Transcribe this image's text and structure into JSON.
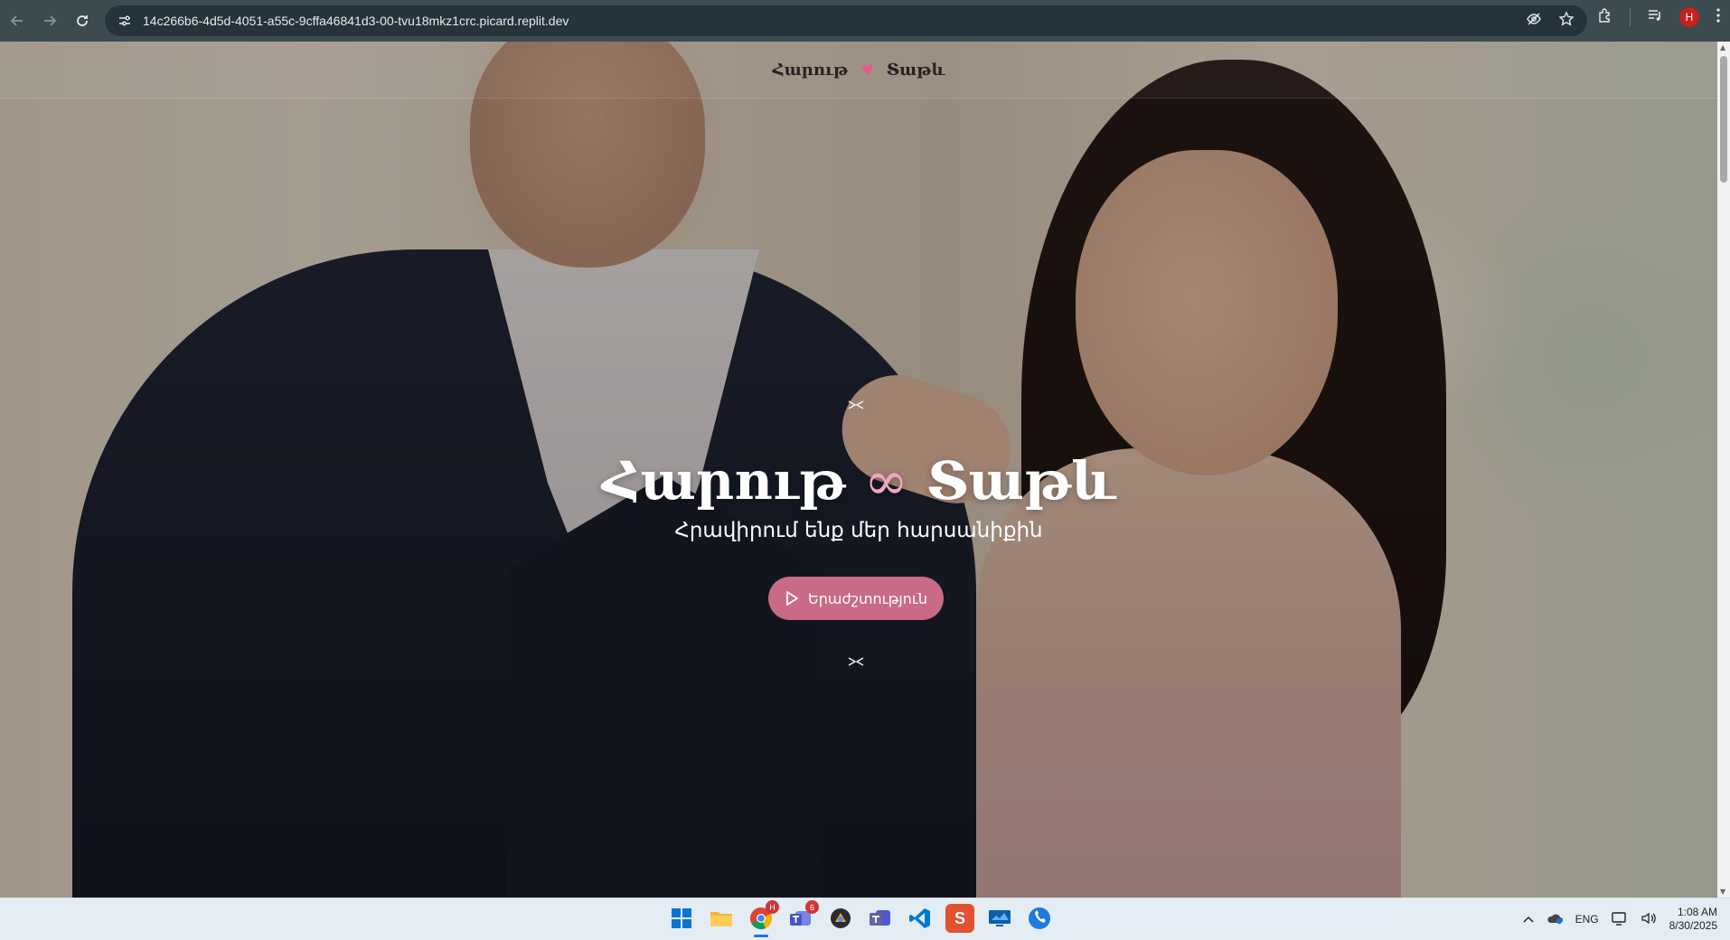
{
  "browser": {
    "url": "14c266b6-4d5d-4051-a55c-9cffa46841d3-00-tvu18mkz1crc.picard.replit.dev",
    "profile_initial": "H",
    "icons": [
      "back-icon",
      "forward-icon",
      "reload-icon",
      "site-info-icon",
      "eye-off-icon",
      "star-icon",
      "extensions-icon",
      "media-icon",
      "menu-icon"
    ]
  },
  "nav": {
    "groom": "Հարութ",
    "bride": "Տաթև",
    "heart": "♥"
  },
  "hero": {
    "ornament": "✂",
    "title_groom": "Հարութ",
    "title_symbol": "∞",
    "title_bride": "Տաթև",
    "subtitle": "Հրավիրում ենք մեր հարսանիքին",
    "music_button": "Երաժշտություն",
    "accent_color": "#c96a87"
  },
  "taskbar": {
    "apps": [
      {
        "name": "start",
        "label": ""
      },
      {
        "name": "file-explorer",
        "label": ""
      },
      {
        "name": "chrome",
        "label": "",
        "badge": "H"
      },
      {
        "name": "teams",
        "label": "",
        "badge": "6"
      },
      {
        "name": "app-circle",
        "label": ""
      },
      {
        "name": "teams-2",
        "label": ""
      },
      {
        "name": "vscode",
        "label": ""
      },
      {
        "name": "sublime",
        "label": "S"
      },
      {
        "name": "remote-desktop",
        "label": ""
      },
      {
        "name": "phone",
        "label": ""
      }
    ],
    "language": "ENG",
    "time": "1:08 AM",
    "date": "8/30/2025"
  }
}
